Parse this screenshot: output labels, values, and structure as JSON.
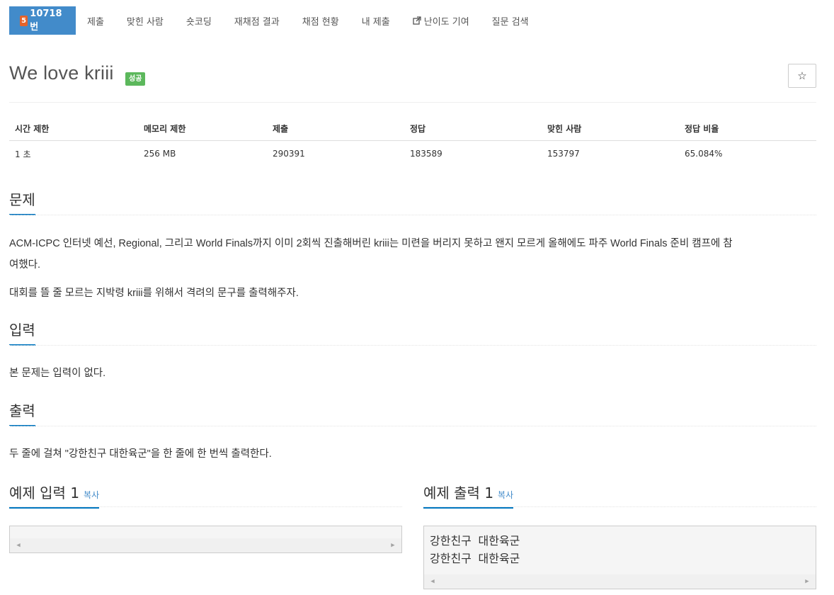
{
  "tabs": {
    "problem_tier": "5",
    "problem_no": "10718번",
    "items": [
      "제출",
      "맞힌 사람",
      "숏코딩",
      "재채점 결과",
      "채점 현황",
      "내 제출",
      "난이도 기여",
      "질문 검색"
    ]
  },
  "title": "We love kriii",
  "badge": "성공",
  "star": "☆",
  "info": {
    "headers": [
      "시간 제한",
      "메모리 제한",
      "제출",
      "정답",
      "맞힌 사람",
      "정답 비율"
    ],
    "values": [
      "1 초",
      "256 MB",
      "290391",
      "183589",
      "153797",
      "65.084%"
    ]
  },
  "sections": {
    "problem_title": "문제",
    "problem_p1_line1": "ACM-ICPC 인터넷 예선, Regional, 그리고 World Finals까지 이미 2회씩 진출해버린 kriii는 미련을 버리지 못하고 왠지 모르게 올해에도 파주 World Finals 준비 캠프에 참",
    "problem_p1_line2": "여했다.",
    "problem_p2": "대회를 뜰 줄 모르는 지박령 kriii를 위해서 격려의 문구를 출력해주자.",
    "input_title": "입력",
    "input_text": "본 문제는 입력이 없다.",
    "output_title": "출력",
    "output_text": "두 줄에 걸쳐 \"강한친구 대한육군\"을 한 줄에 한 번씩 출력한다."
  },
  "samples": {
    "input_title": "예제 입력 1",
    "output_title": "예제 출력 1",
    "copy_label": "복사",
    "input_text": "",
    "output_text": "강한친구 대한육군\n강한친구 대한육군"
  },
  "colors": {
    "active_tab": "#428bca",
    "tier_badge": "#e5632b",
    "success_badge": "#5cb85c",
    "heading_underline": "#0076c0"
  }
}
